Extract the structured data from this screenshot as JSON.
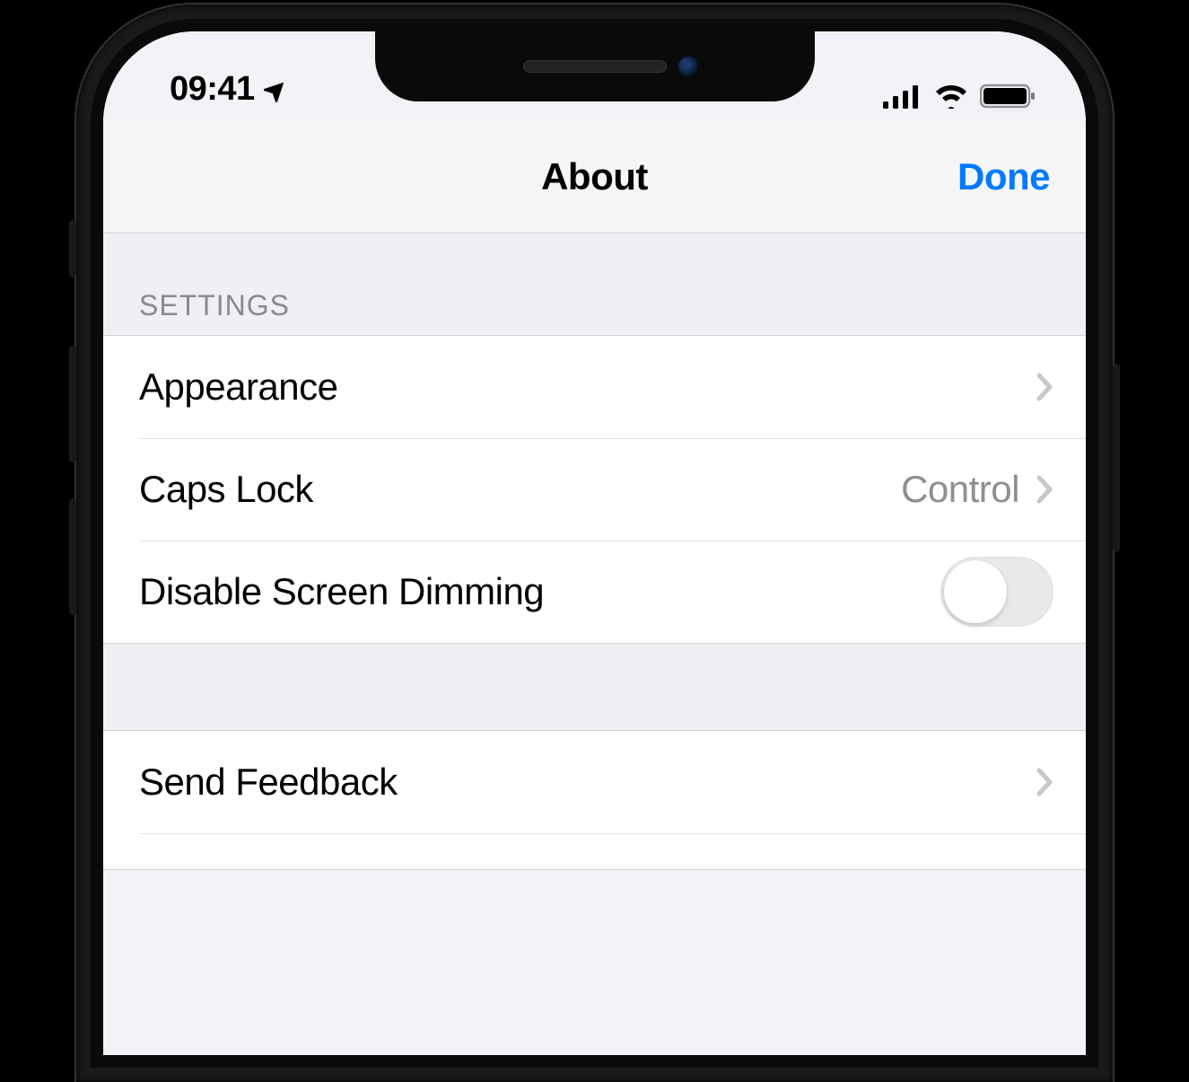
{
  "status": {
    "time": "09:41"
  },
  "nav": {
    "title": "About",
    "done": "Done"
  },
  "section_header": "Settings",
  "rows": {
    "appearance": "Appearance",
    "capslock_label": "Caps Lock",
    "capslock_value": "Control",
    "dimming": "Disable Screen Dimming",
    "feedback": "Send Feedback"
  }
}
